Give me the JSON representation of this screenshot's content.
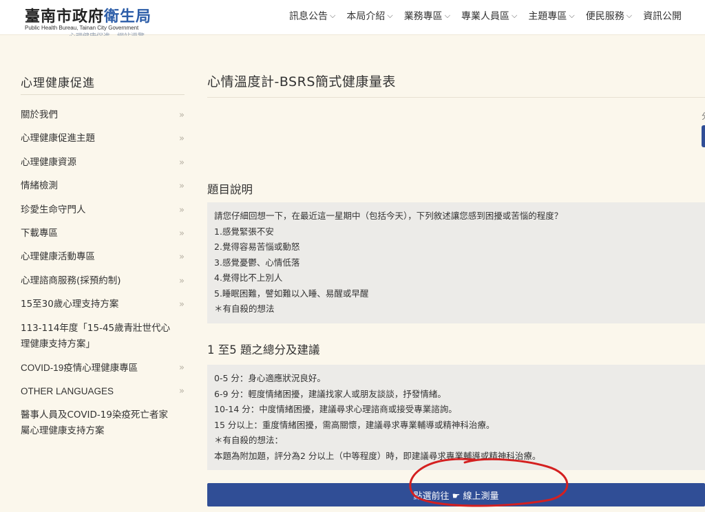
{
  "header": {
    "logo_prefix": "臺南市政府",
    "logo_accent": "衛生局",
    "logo_sub": "Public Health Bureau, Tainan City Government",
    "ghost_text": "心理健康促進　網站導覽",
    "nav": [
      "訊息公告",
      "本局介紹",
      "業務專區",
      "專業人員區",
      "主題專區",
      "便民服務",
      "資訊公開"
    ]
  },
  "sidebar": {
    "title": "心理健康促進",
    "items": [
      {
        "label": "關於我們"
      },
      {
        "label": "心理健康促進主題"
      },
      {
        "label": "心理健康資源"
      },
      {
        "label": "情緒檢測"
      },
      {
        "label": "珍愛生命守門人"
      },
      {
        "label": "下載專區"
      },
      {
        "label": "心理健康活動專區"
      },
      {
        "label": "心理諮商服務(採預約制)"
      },
      {
        "label": "15至30歲心理支持方案"
      },
      {
        "label": "113-114年度「15-45歲青壯世代心理健康支持方案」"
      },
      {
        "label": "COVID-19疫情心理健康專區"
      },
      {
        "label": "OTHER LANGUAGES"
      },
      {
        "label": "醫事人員及COVID-19染疫死亡者家屬心理健康支持方案"
      }
    ],
    "arrow": "»"
  },
  "main": {
    "title": "心情溫度計-BSRS簡式健康量表",
    "side_stub": "分",
    "section1_title": "題目說明",
    "section1_lines": [
      "請您仔細回想一下，在最近這一星期中（包括今天），下列敘述讓您感到困擾或苦惱的程度？",
      "1.感覺緊張不安",
      "2.覺得容易苦惱或動怒",
      "3.感覺憂鬱、心情低落",
      "4.覺得比不上別人",
      "5.睡眠困難，譬如難以入睡、易醒或早醒",
      "＊有自殺的想法"
    ],
    "section2_title": "1 至5 題之總分及建議",
    "section2_lines": [
      "0-5 分：身心適應狀況良好。",
      "6-9 分：輕度情緒困擾，建議找家人或朋友談談，抒發情緒。",
      "10-14 分：中度情緒困擾，建議尋求心理諮商或接受專業諮詢。",
      "15 分以上：重度情緒困擾，需高關懷，建議尋求專業輔導或精神科治療。",
      "＊有自殺的想法：",
      "本題為附加題，評分為2 分以上（中等程度）時，即建議尋求專業輔導或精神科治療。"
    ],
    "cta_label": "點選前往 ☛ 線上測量"
  },
  "colors": {
    "page_bg": "#fbf7ec",
    "accent": "#2c5da8",
    "button_bg": "#304e96",
    "box_bg": "#ecebe8",
    "annotation": "#d42020"
  }
}
